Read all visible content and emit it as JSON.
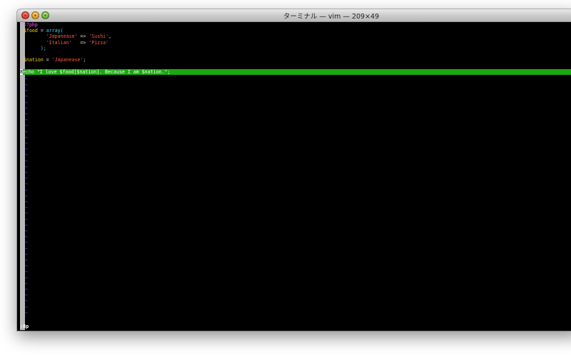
{
  "window": {
    "title": "ターミナル — vim — 209×49"
  },
  "editor": {
    "lines": [
      {
        "parts": [
          {
            "t": "<?php",
            "c": "kw"
          }
        ]
      },
      {
        "parts": [
          {
            "t": "$food",
            "c": "var"
          },
          {
            "t": " = ",
            "c": "op"
          },
          {
            "t": "array(",
            "c": "fn"
          }
        ]
      },
      {
        "parts": [
          {
            "t": "        ",
            "c": "op"
          },
          {
            "t": "'Japanease'",
            "c": "str"
          },
          {
            "t": " => ",
            "c": "op"
          },
          {
            "t": "'Sushi'",
            "c": "str"
          },
          {
            "t": ",",
            "c": "op"
          }
        ]
      },
      {
        "parts": [
          {
            "t": "        ",
            "c": "op"
          },
          {
            "t": "'Italian'",
            "c": "str"
          },
          {
            "t": "   => ",
            "c": "op"
          },
          {
            "t": "'Pizza'",
            "c": "str"
          }
        ]
      },
      {
        "parts": [
          {
            "t": "      );",
            "c": "fn"
          }
        ]
      },
      {
        "parts": []
      },
      {
        "parts": [
          {
            "t": "$nation",
            "c": "var"
          },
          {
            "t": " = ",
            "c": "op"
          },
          {
            "t": "'Japanease'",
            "c": "str"
          },
          {
            "t": ";",
            "c": "op"
          }
        ]
      },
      {
        "parts": []
      },
      {
        "cursor": true,
        "cursor_char": "8",
        "text": "echo \"I love $food[$nation]. Because I am $nation.\";"
      }
    ],
    "tilde": "~",
    "tilde_count": 41,
    "command_line": ":8p"
  },
  "colors": {
    "background": "#000000",
    "cursorline": "#1aa810",
    "keyword": "#ff55ff",
    "variable": "#ffd11a",
    "string": "#ff5a3d",
    "function": "#3ad8ff",
    "tilde": "#3a3aff"
  }
}
